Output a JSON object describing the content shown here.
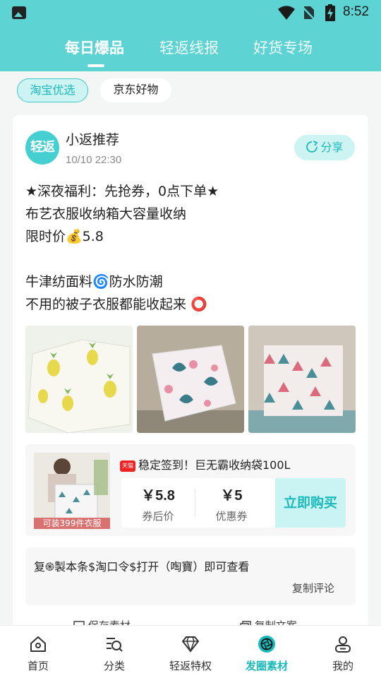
{
  "status_bar": {
    "time": "8:52"
  },
  "top_tabs": [
    {
      "label": "每日爆品",
      "active": true
    },
    {
      "label": "轻返线报",
      "active": false
    },
    {
      "label": "好货专场",
      "active": false
    }
  ],
  "chips": [
    {
      "label": "淘宝优选",
      "active": true
    },
    {
      "label": "京东好物",
      "active": false
    }
  ],
  "post": {
    "avatar_text": "轻返",
    "author": "小返推荐",
    "time": "10/10 22:30",
    "share_label": "分享",
    "content": "★深夜福利：先抢券，0点下单★\n布艺衣服收纳箱大容量收纳\n限时价💰5.8\n\n牛津纺面料🌀防水防潮\n不用的被子衣服都能收起来 ⭕",
    "product": {
      "thumb_caption": "可装399件衣服",
      "tmall_badge": "天猫",
      "title": "稳定签到！巨无霸收纳袋100L",
      "final_price": "￥5.8",
      "final_price_label": "券后价",
      "coupon": "￥5",
      "coupon_label": "优惠券",
      "buy_label": "立即购买"
    },
    "command_text": "复֍製本条$淘口令$打开（啕寶）即可查看",
    "copy_comment_label": "复制评论",
    "save_material_label": "保存素材",
    "copy_text_label": "复制文案"
  },
  "bottom_nav": [
    {
      "label": "首页",
      "icon": "home-icon",
      "active": false
    },
    {
      "label": "分类",
      "icon": "category-search-icon",
      "active": false
    },
    {
      "label": "轻返特权",
      "icon": "diamond-icon",
      "active": false
    },
    {
      "label": "发圈素材",
      "icon": "aperture-icon",
      "active": true
    },
    {
      "label": "我的",
      "icon": "user-icon",
      "active": false
    }
  ],
  "colors": {
    "accent": "#5dd3d3",
    "accent_text": "#1bb9ba",
    "background": "#f4f5f5"
  }
}
